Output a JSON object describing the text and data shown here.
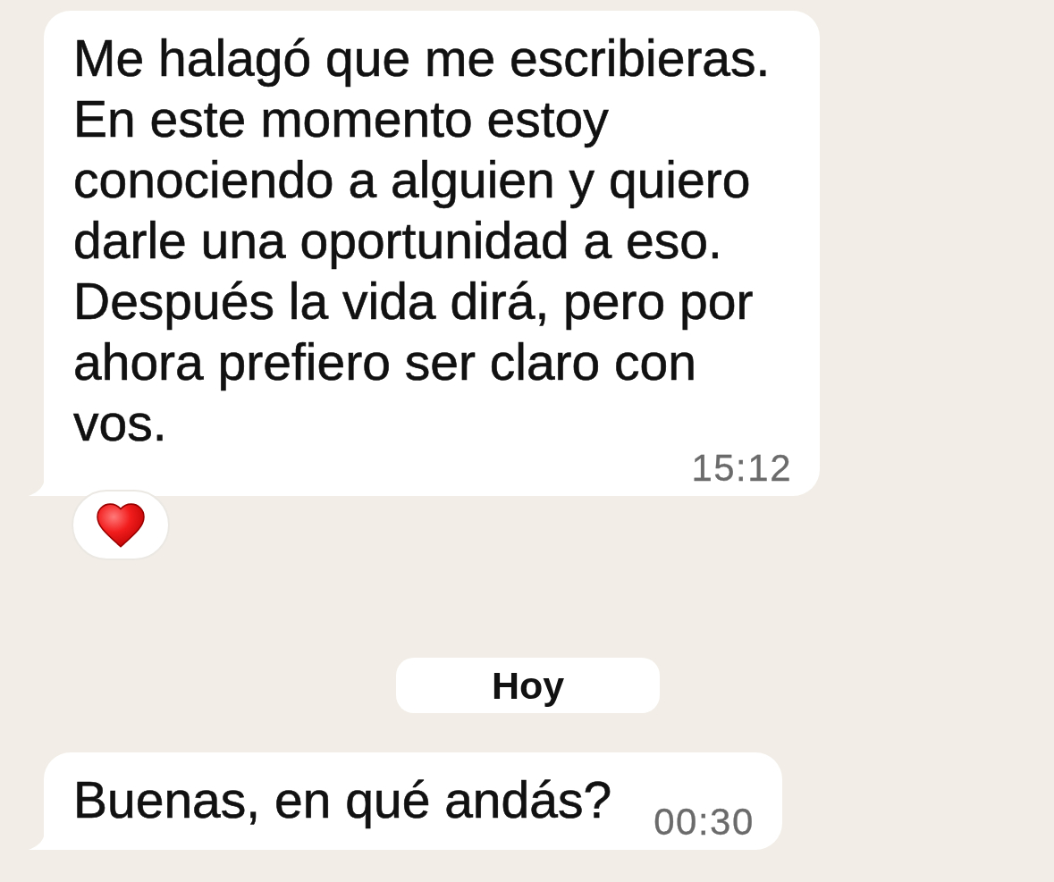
{
  "messages": [
    {
      "kind": "bubble",
      "text": "Me halagó que me escribieras. En este momento estoy conociendo a alguien y quiero darle una oportunidad a eso. Después la vida dirá, pero por ahora prefiero ser claro con vos.",
      "time": "15:12",
      "reaction": true
    },
    {
      "kind": "date",
      "text": "Hoy"
    },
    {
      "kind": "bubble",
      "text": "Buenas, en qué andás?",
      "time": "00:30",
      "reaction": false
    }
  ]
}
